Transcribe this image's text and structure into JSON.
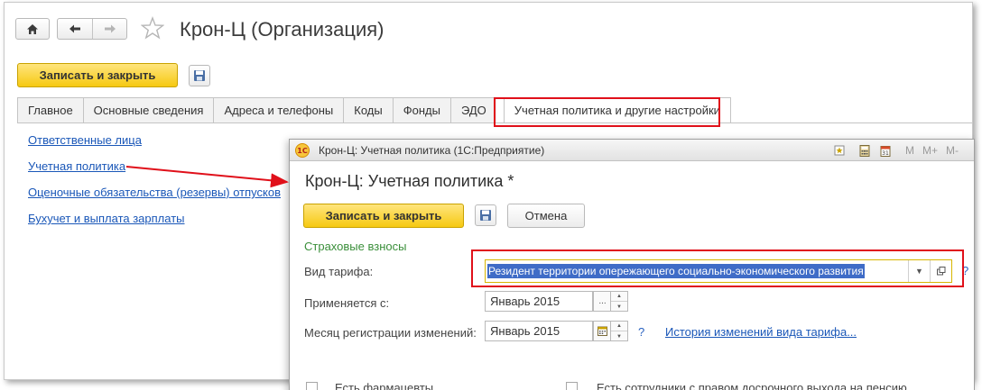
{
  "window": {
    "title": "Крон-Ц (Организация)",
    "save_close_label": "Записать и закрыть"
  },
  "nav": {
    "home_icon": "home-icon",
    "back_icon": "arrow-left-icon",
    "forward_icon": "arrow-right-icon",
    "favorite_icon": "star-icon"
  },
  "tabs": [
    {
      "label": "Главное"
    },
    {
      "label": "Основные сведения"
    },
    {
      "label": "Адреса и телефоны"
    },
    {
      "label": "Коды"
    },
    {
      "label": "Фонды"
    },
    {
      "label": "ЭДО"
    },
    {
      "label": "Учетная политика и другие настройки",
      "active": true
    }
  ],
  "side_links": [
    {
      "label": "Ответственные лица"
    },
    {
      "label": "Учетная политика"
    },
    {
      "label": "Оценочные обязательства (резервы) отпусков"
    },
    {
      "label": "Бухучет и выплата зарплаты"
    }
  ],
  "dialog": {
    "window_title": "Крон-Ц: Учетная политика  (1С:Предприятие)",
    "logo_text": "1С",
    "toolbar_m": [
      "M",
      "M+",
      "M-"
    ],
    "title": "Крон-Ц: Учетная политика *",
    "save_close_label": "Записать и закрыть",
    "cancel_label": "Отмена",
    "section_title": "Страховые взносы",
    "tariff_label": "Вид тарифа:",
    "tariff_value": "Резидент территории опережающего социально-экономического развития",
    "applies_label": "Применяется с:",
    "applies_value": "Январь 2015",
    "reg_month_label": "Месяц регистрации изменений:",
    "reg_month_value": "Январь 2015",
    "help": "?",
    "history_link": "История изменений вида тарифа...",
    "checkbox_pharmacists": "Есть фармацевты",
    "checkbox_early_pension": "Есть сотрудники с правом досрочного выхода на пенсию",
    "select_ellipsis": "..."
  },
  "colors": {
    "accent_yellow": "#f6c912",
    "highlight_red": "#e0101a",
    "link_blue": "#1a57b8",
    "section_green": "#3a8f3a"
  }
}
